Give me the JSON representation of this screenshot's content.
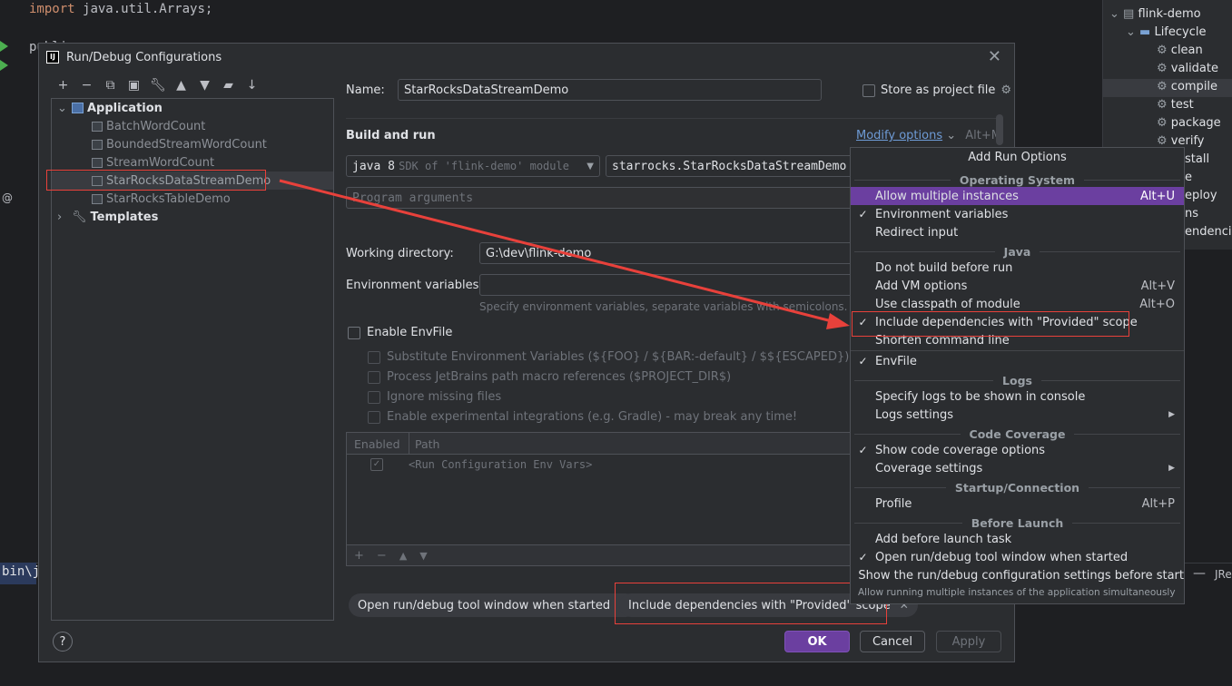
{
  "editor": {
    "line1": "import java.util.Arrays;",
    "line2": "public",
    "bin_text": "bin\\j",
    "at_symbol": "@"
  },
  "project_tree": {
    "items": [
      {
        "label": "flink-demo"
      },
      {
        "label": "Lifecycle"
      },
      {
        "label": "clean"
      },
      {
        "label": "validate"
      },
      {
        "label": "compile"
      },
      {
        "label": "test"
      },
      {
        "label": "package"
      },
      {
        "label": "verify"
      },
      {
        "label": "stall"
      },
      {
        "label": "e"
      },
      {
        "label": "eploy"
      },
      {
        "label": "ns"
      },
      {
        "label": "endencies"
      }
    ],
    "jre_fragment": "JRe"
  },
  "dialog": {
    "title": "Run/Debug Configurations",
    "tree": {
      "application": "Application",
      "configs": [
        "BatchWordCount",
        "BoundedStreamWordCount",
        "StreamWordCount",
        "StarRocksDataStreamDemo",
        "StarRocksTableDemo"
      ],
      "templates": "Templates"
    },
    "name_label": "Name:",
    "name_value": "StarRocksDataStreamDemo",
    "store_label": "Store as project file",
    "build_run_label": "Build and run",
    "modify_options": "Modify options",
    "modify_shortcut": "Alt+M",
    "jdk_value": "java 8",
    "jdk_hint": "SDK of 'flink-demo' module",
    "main_class": "starrocks.StarRocksDataStreamDemo",
    "program_args_placeholder": "Program arguments",
    "working_dir_label": "Working directory:",
    "working_dir_value": "G:\\dev\\flink-demo",
    "env_vars_label": "Environment variables:",
    "env_vars_hint": "Specify environment variables, separate variables with semicolons. Exa",
    "enable_envfile": "Enable EnvFile",
    "envfile_options": [
      "Substitute Environment Variables (${FOO} / ${BAR:-default} / $${ESCAPED})",
      "Process JetBrains path macro references ($PROJECT_DIR$)",
      "Ignore missing files",
      "Enable experimental integrations (e.g. Gradle) - may break any time!"
    ],
    "table_headers": {
      "enabled": "Enabled",
      "path": "Path"
    },
    "table_row": "<Run Configuration Env Vars>",
    "chips": [
      "Open run/debug tool window when started",
      "Include dependencies with \"Provided\" scope"
    ],
    "ok": "OK",
    "cancel": "Cancel",
    "apply": "Apply",
    "help": "?"
  },
  "popup": {
    "title": "Add Run Options",
    "sections": {
      "os": "Operating System",
      "java": "Java",
      "logs": "Logs",
      "coverage": "Code Coverage",
      "startup": "Startup/Connection",
      "before": "Before Launch"
    },
    "items": {
      "allow_multiple": {
        "label": "Allow multiple instances",
        "shortcut": "Alt+U"
      },
      "env_vars": {
        "label": "Environment variables"
      },
      "redirect_input": {
        "label": "Redirect input"
      },
      "do_not_build": {
        "label": "Do not build before run"
      },
      "add_vm": {
        "label": "Add VM options",
        "shortcut": "Alt+V"
      },
      "classpath": {
        "label": "Use classpath of module",
        "shortcut": "Alt+O"
      },
      "include_deps": {
        "label": "Include dependencies with \"Provided\" scope"
      },
      "shorten": {
        "label": "Shorten command line"
      },
      "envfile": {
        "label": "EnvFile"
      },
      "specify_logs": {
        "label": "Specify logs to be shown in console"
      },
      "logs_settings": {
        "label": "Logs settings"
      },
      "show_coverage": {
        "label": "Show code coverage options"
      },
      "coverage_settings": {
        "label": "Coverage settings"
      },
      "profile": {
        "label": "Profile",
        "shortcut": "Alt+P"
      },
      "add_before": {
        "label": "Add before launch task"
      },
      "open_tool": {
        "label": "Open run/debug tool window when started"
      },
      "show_settings": {
        "label": "Show the run/debug configuration settings before start"
      }
    },
    "check_glyph": "✓",
    "submenu_glyph": "▶",
    "tooltip": "Allow running multiple instances of the application simultaneously"
  }
}
